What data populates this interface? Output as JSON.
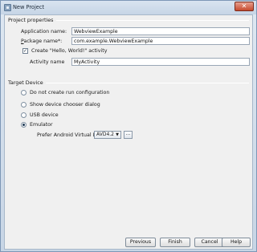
{
  "window": {
    "title": "New Project",
    "close_glyph": "✕"
  },
  "project_properties": {
    "group_label": "Project properties",
    "application_name": {
      "label": "Application name:",
      "value": "WebviewExample"
    },
    "package_name": {
      "label": "Package name*:",
      "value": "com.example.WebviewExample"
    },
    "create_activity": {
      "label": "Create \"Hello, World!\" activity",
      "checked": true,
      "check_glyph": "✓"
    },
    "activity_name": {
      "label": "Activity name",
      "value": "MyActivity"
    }
  },
  "target_device": {
    "group_label": "Target Device",
    "options": [
      {
        "label": "Do not create run configuration",
        "selected": false
      },
      {
        "label": "Show device chooser dialog",
        "selected": false
      },
      {
        "label": "USB device",
        "selected": false
      },
      {
        "label": "Emulator",
        "selected": true
      }
    ],
    "prefer_avd": {
      "label": "Prefer Android Virtual Device:",
      "value": "AVD4.2",
      "arrow_glyph": "▼",
      "browse_label": "..."
    }
  },
  "buttons": {
    "previous": "Previous",
    "finish": "Finish",
    "cancel": "Cancel",
    "help": "Help"
  },
  "icons": {
    "app": "app-icon",
    "close": "close-icon",
    "dropdown": "chevron-down-icon"
  }
}
